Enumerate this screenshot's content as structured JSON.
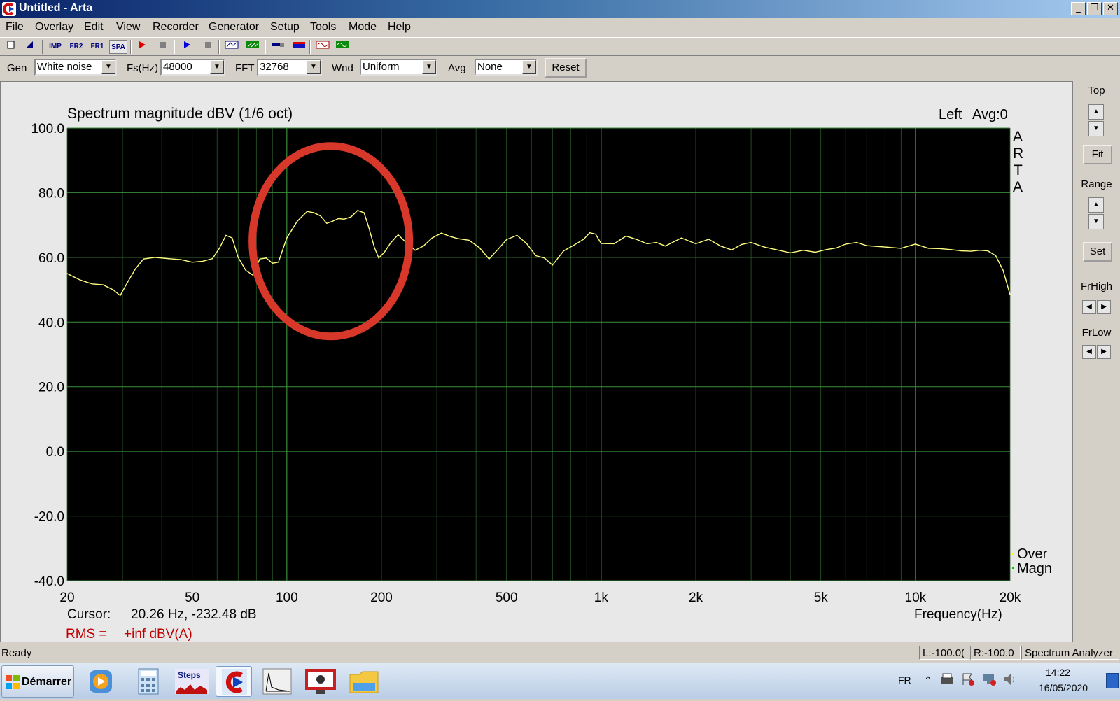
{
  "window": {
    "title": "Untitled - Arta",
    "min_glyph": "_",
    "restore_glyph": "❐",
    "close_glyph": "✕"
  },
  "menu": [
    "File",
    "Overlay",
    "Edit",
    "View",
    "Recorder",
    "Generator",
    "Setup",
    "Tools",
    "Mode",
    "Help"
  ],
  "toolbar": {
    "buttons": [
      "new-icon",
      "open-icon",
      "imp",
      "fr2",
      "fr1",
      "spa",
      "record-icon",
      "stop-icon",
      "play-icon",
      "stop-icon",
      "abc-icon",
      "pattern-icon",
      "probe-icon",
      "meter-icon",
      "scope-icon",
      "wave-icon"
    ],
    "labels": {
      "imp": "IMP",
      "fr2": "FR2",
      "fr1": "FR1",
      "spa": "SPA"
    }
  },
  "controls": {
    "gen_label": "Gen",
    "gen_value": "White noise",
    "fs_label": "Fs(Hz)",
    "fs_value": "48000",
    "fft_label": "FFT",
    "fft_value": "32768",
    "wnd_label": "Wnd",
    "wnd_value": "Uniform",
    "avg_label": "Avg",
    "avg_value": "None",
    "reset_label": "Reset"
  },
  "right_panel": {
    "top_label": "Top",
    "fit_label": "Fit",
    "range_label": "Range",
    "set_label": "Set",
    "frhigh_label": "FrHigh",
    "frlow_label": "FrLow",
    "up_glyph": "▲",
    "down_glyph": "▼",
    "left_glyph": "◀",
    "right_glyph": "▶"
  },
  "chart_data": {
    "type": "line",
    "title": "Spectrum magnitude dBV (1/6 oct)",
    "channel_label": "Left",
    "avg_label": "Avg:0",
    "watermark": [
      "A",
      "R",
      "T",
      "A"
    ],
    "xlabel": "Frequency(Hz)",
    "xscale": "log",
    "xlim": [
      20,
      20000
    ],
    "ylim": [
      -40,
      100
    ],
    "yticks": [
      "100.0",
      "80.0",
      "60.0",
      "40.0",
      "20.0",
      "0.0",
      "-20.0",
      "-40.0"
    ],
    "xticks": [
      {
        "value": 20,
        "label": "20"
      },
      {
        "value": 50,
        "label": "50"
      },
      {
        "value": 100,
        "label": "100"
      },
      {
        "value": 200,
        "label": "200"
      },
      {
        "value": 500,
        "label": "500"
      },
      {
        "value": 1000,
        "label": "1k"
      },
      {
        "value": 2000,
        "label": "2k"
      },
      {
        "value": 5000,
        "label": "5k"
      },
      {
        "value": 10000,
        "label": "10k"
      },
      {
        "value": 20000,
        "label": "20k"
      }
    ],
    "legend": [
      {
        "name": "Over",
        "color": "#ffff00"
      },
      {
        "name": "Magn",
        "color": "#00c000"
      }
    ],
    "series": [
      {
        "color": "#ffff80",
        "x": [
          20,
          22,
          24,
          26,
          28,
          29.5,
          31,
          33,
          35,
          38,
          42,
          46,
          50,
          54,
          58,
          61,
          64,
          67,
          70,
          74,
          78,
          82,
          86,
          90,
          94,
          100,
          108,
          116,
          122,
          128,
          134,
          140,
          146,
          152,
          160,
          168,
          176,
          182,
          190,
          196,
          204,
          214,
          226,
          240,
          256,
          272,
          290,
          310,
          330,
          350,
          380,
          410,
          440,
          470,
          500,
          540,
          580,
          620,
          660,
          700,
          760,
          820,
          880,
          920,
          960,
          1000,
          1100,
          1200,
          1300,
          1400,
          1500,
          1600,
          1800,
          2000,
          2200,
          2400,
          2600,
          2800,
          3000,
          3300,
          3600,
          4000,
          4400,
          4800,
          5200,
          5600,
          6000,
          6500,
          7000,
          8000,
          9000,
          10000,
          11000,
          12000,
          13000,
          14000,
          15000,
          16000,
          17000,
          18000,
          19000,
          20000
        ],
        "y": [
          55.0,
          53.0,
          51.8,
          51.5,
          50.0,
          48.2,
          52.0,
          56.5,
          59.5,
          60.0,
          59.6,
          59.3,
          58.5,
          58.8,
          59.6,
          62.8,
          66.8,
          66.0,
          60.0,
          56.0,
          54.5,
          59.5,
          59.8,
          58.2,
          58.5,
          66.0,
          71.2,
          74.2,
          73.8,
          72.8,
          70.5,
          71.2,
          72.0,
          71.8,
          72.5,
          74.5,
          73.8,
          69.5,
          63.0,
          59.8,
          61.5,
          64.5,
          67.0,
          64.5,
          62.2,
          63.5,
          66.0,
          67.5,
          66.5,
          65.8,
          65.3,
          63.0,
          59.5,
          62.5,
          65.5,
          66.8,
          64.2,
          60.5,
          59.8,
          57.6,
          62.0,
          63.8,
          65.6,
          67.6,
          67.2,
          64.3,
          64.2,
          66.6,
          65.5,
          64.2,
          64.6,
          63.5,
          66.0,
          64.2,
          65.6,
          63.5,
          62.3,
          64.0,
          64.6,
          63.2,
          62.4,
          61.4,
          62.2,
          61.6,
          62.4,
          62.9,
          64.1,
          64.6,
          63.6,
          63.2,
          62.8,
          64.1,
          62.8,
          62.7,
          62.4,
          62.0,
          61.9,
          62.2,
          62.0,
          60.5,
          56.0,
          48.5
        ]
      }
    ],
    "cursor_label": "Cursor:",
    "cursor_value": "20.26 Hz, -232.48 dB",
    "rms_label": "RMS =",
    "rms_value": "+inf dBV(A)",
    "annotation": {
      "type": "ellipse",
      "color": "#d8382a",
      "x_center": 138,
      "y_center": 65,
      "note": "red hand-drawn circle"
    }
  },
  "status": {
    "ready": "Ready",
    "left": "L:-100.0(",
    "right": "R:-100.0",
    "mode": "Spectrum Analyzer"
  },
  "taskbar": {
    "start_label": "Démarrer",
    "tasks": [
      "media-player-icon",
      "calculator-icon",
      "steps-icon",
      "arta-icon",
      "limp-icon",
      "video-icon",
      "explorer-icon"
    ],
    "steps_label": "Steps",
    "lang": "FR",
    "time": "14:22",
    "date": "16/05/2020"
  }
}
